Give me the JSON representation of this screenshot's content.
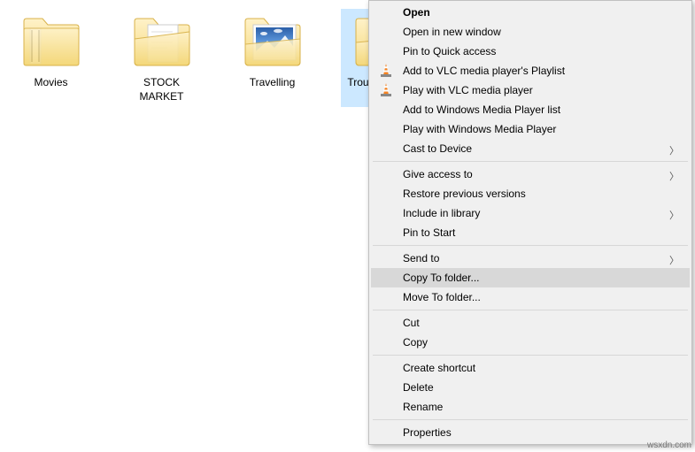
{
  "folders": [
    {
      "label": "Movies",
      "type": "folder"
    },
    {
      "label": "STOCK MARKET",
      "type": "folder-doc"
    },
    {
      "label": "Travelling",
      "type": "folder-photo"
    },
    {
      "label": "Troubleshooter\nWork",
      "type": "folder-docs",
      "selected": true
    }
  ],
  "contextMenu": {
    "items": [
      {
        "label": "Open",
        "bold": true
      },
      {
        "label": "Open in new window"
      },
      {
        "label": "Pin to Quick access"
      },
      {
        "label": "Add to VLC media player's Playlist",
        "icon": "vlc"
      },
      {
        "label": "Play with VLC media player",
        "icon": "vlc"
      },
      {
        "label": "Add to Windows Media Player list"
      },
      {
        "label": "Play with Windows Media Player"
      },
      {
        "label": "Cast to Device",
        "submenu": true
      },
      {
        "sep": true
      },
      {
        "label": "Give access to",
        "submenu": true
      },
      {
        "label": "Restore previous versions"
      },
      {
        "label": "Include in library",
        "submenu": true
      },
      {
        "label": "Pin to Start"
      },
      {
        "sep": true
      },
      {
        "label": "Send to",
        "submenu": true
      },
      {
        "label": "Copy To folder...",
        "hover": true
      },
      {
        "label": "Move To folder..."
      },
      {
        "sep": true
      },
      {
        "label": "Cut"
      },
      {
        "label": "Copy"
      },
      {
        "sep": true
      },
      {
        "label": "Create shortcut"
      },
      {
        "label": "Delete"
      },
      {
        "label": "Rename"
      },
      {
        "sep": true
      },
      {
        "label": "Properties"
      }
    ]
  },
  "watermark": "wsxdn.com"
}
